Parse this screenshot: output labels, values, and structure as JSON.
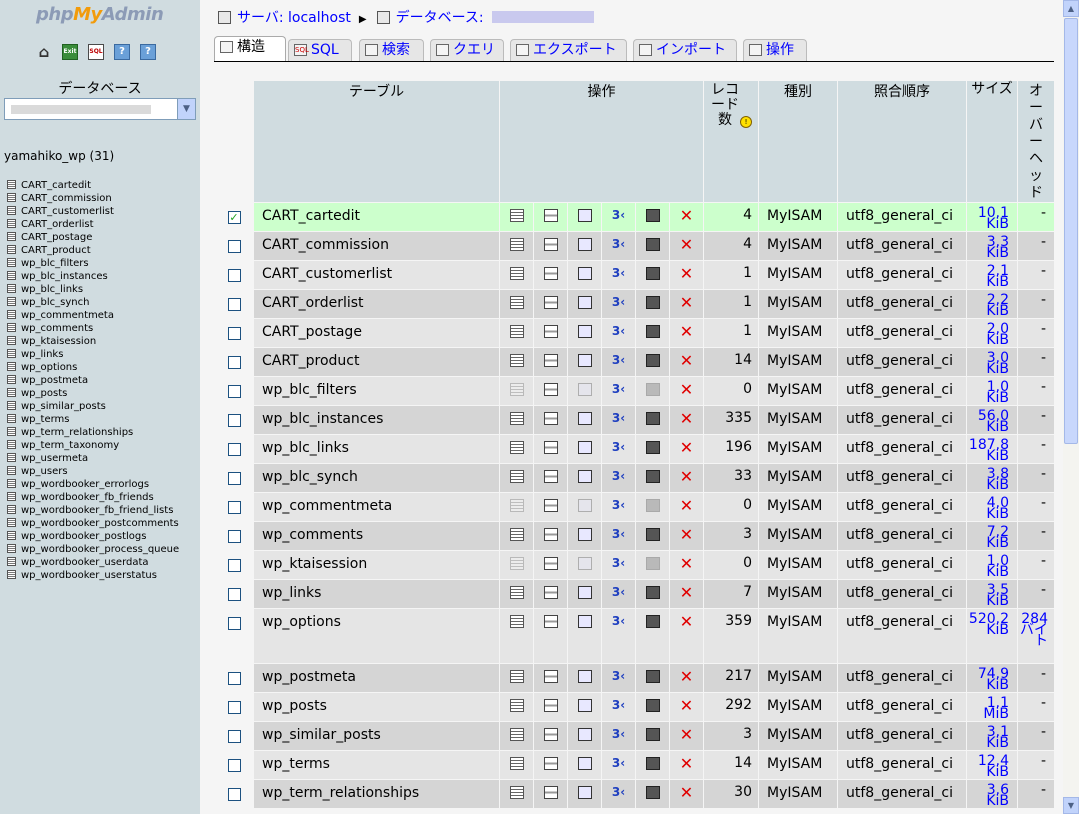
{
  "nav": {
    "logo_php": "php",
    "logo_my": "My",
    "logo_admin": "Admin",
    "database_label": "データベース",
    "current_db": "yamahiko_wp (31)",
    "tables": [
      "CART_cartedit",
      "CART_commission",
      "CART_customerlist",
      "CART_orderlist",
      "CART_postage",
      "CART_product",
      "wp_blc_filters",
      "wp_blc_instances",
      "wp_blc_links",
      "wp_blc_synch",
      "wp_commentmeta",
      "wp_comments",
      "wp_ktaisession",
      "wp_links",
      "wp_options",
      "wp_postmeta",
      "wp_posts",
      "wp_similar_posts",
      "wp_terms",
      "wp_term_relationships",
      "wp_term_taxonomy",
      "wp_usermeta",
      "wp_users",
      "wp_wordbooker_errorlogs",
      "wp_wordbooker_fb_friends",
      "wp_wordbooker_fb_friend_lists",
      "wp_wordbooker_postcomments",
      "wp_wordbooker_postlogs",
      "wp_wordbooker_process_queue",
      "wp_wordbooker_userdata",
      "wp_wordbooker_userstatus"
    ]
  },
  "breadcrumb": {
    "server": "サーバ: localhost",
    "database": "データベース:"
  },
  "tabs": [
    {
      "label": "構造",
      "icon": "structure-icon",
      "active": true
    },
    {
      "label": "SQL",
      "icon": "sql-icon",
      "active": false
    },
    {
      "label": "検索",
      "icon": "search-icon",
      "active": false
    },
    {
      "label": "クエリ",
      "icon": "query-icon",
      "active": false
    },
    {
      "label": "エクスポート",
      "icon": "export-icon",
      "active": false
    },
    {
      "label": "インポート",
      "icon": "import-icon",
      "active": false
    },
    {
      "label": "操作",
      "icon": "operations-icon",
      "active": false
    }
  ],
  "table_headers": {
    "table": "テーブル",
    "action": "操作",
    "records": "レコード数",
    "type": "種別",
    "collation": "照合順序",
    "size": "サイズ",
    "overhead": "オーバーヘッド"
  },
  "rows": [
    {
      "name": "CART_cartedit",
      "records": "4",
      "engine": "MyISAM",
      "collation": "utf8_general_ci",
      "size": "10.1 KiB",
      "overhead": "-",
      "checked": true,
      "empty": false
    },
    {
      "name": "CART_commission",
      "records": "4",
      "engine": "MyISAM",
      "collation": "utf8_general_ci",
      "size": "3.3 KiB",
      "overhead": "-",
      "checked": false,
      "empty": false
    },
    {
      "name": "CART_customerlist",
      "records": "1",
      "engine": "MyISAM",
      "collation": "utf8_general_ci",
      "size": "2.1 KiB",
      "overhead": "-",
      "checked": false,
      "empty": false
    },
    {
      "name": "CART_orderlist",
      "records": "1",
      "engine": "MyISAM",
      "collation": "utf8_general_ci",
      "size": "2.2 KiB",
      "overhead": "-",
      "checked": false,
      "empty": false
    },
    {
      "name": "CART_postage",
      "records": "1",
      "engine": "MyISAM",
      "collation": "utf8_general_ci",
      "size": "2.0 KiB",
      "overhead": "-",
      "checked": false,
      "empty": false
    },
    {
      "name": "CART_product",
      "records": "14",
      "engine": "MyISAM",
      "collation": "utf8_general_ci",
      "size": "3.0 KiB",
      "overhead": "-",
      "checked": false,
      "empty": false
    },
    {
      "name": "wp_blc_filters",
      "records": "0",
      "engine": "MyISAM",
      "collation": "utf8_general_ci",
      "size": "1.0 KiB",
      "overhead": "-",
      "checked": false,
      "empty": true
    },
    {
      "name": "wp_blc_instances",
      "records": "335",
      "engine": "MyISAM",
      "collation": "utf8_general_ci",
      "size": "56.0 KiB",
      "overhead": "-",
      "checked": false,
      "empty": false
    },
    {
      "name": "wp_blc_links",
      "records": "196",
      "engine": "MyISAM",
      "collation": "utf8_general_ci",
      "size": "187.8 KiB",
      "overhead": "-",
      "checked": false,
      "empty": false
    },
    {
      "name": "wp_blc_synch",
      "records": "33",
      "engine": "MyISAM",
      "collation": "utf8_general_ci",
      "size": "3.8 KiB",
      "overhead": "-",
      "checked": false,
      "empty": false
    },
    {
      "name": "wp_commentmeta",
      "records": "0",
      "engine": "MyISAM",
      "collation": "utf8_general_ci",
      "size": "4.0 KiB",
      "overhead": "-",
      "checked": false,
      "empty": true
    },
    {
      "name": "wp_comments",
      "records": "3",
      "engine": "MyISAM",
      "collation": "utf8_general_ci",
      "size": "7.2 KiB",
      "overhead": "-",
      "checked": false,
      "empty": false
    },
    {
      "name": "wp_ktaisession",
      "records": "0",
      "engine": "MyISAM",
      "collation": "utf8_general_ci",
      "size": "1.0 KiB",
      "overhead": "-",
      "checked": false,
      "empty": true
    },
    {
      "name": "wp_links",
      "records": "7",
      "engine": "MyISAM",
      "collation": "utf8_general_ci",
      "size": "3.5 KiB",
      "overhead": "-",
      "checked": false,
      "empty": false
    },
    {
      "name": "wp_options",
      "records": "359",
      "engine": "MyISAM",
      "collation": "utf8_general_ci",
      "size": "520.2 KiB",
      "overhead": "284 バイト",
      "checked": false,
      "empty": false,
      "tall": true
    },
    {
      "name": "wp_postmeta",
      "records": "217",
      "engine": "MyISAM",
      "collation": "utf8_general_ci",
      "size": "74.9 KiB",
      "overhead": "-",
      "checked": false,
      "empty": false
    },
    {
      "name": "wp_posts",
      "records": "292",
      "engine": "MyISAM",
      "collation": "utf8_general_ci",
      "size": "1.1 MiB",
      "overhead": "-",
      "checked": false,
      "empty": false
    },
    {
      "name": "wp_similar_posts",
      "records": "3",
      "engine": "MyISAM",
      "collation": "utf8_general_ci",
      "size": "3.1 KiB",
      "overhead": "-",
      "checked": false,
      "empty": false
    },
    {
      "name": "wp_terms",
      "records": "14",
      "engine": "MyISAM",
      "collation": "utf8_general_ci",
      "size": "12.4 KiB",
      "overhead": "-",
      "checked": false,
      "empty": false
    },
    {
      "name": "wp_term_relationships",
      "records": "30",
      "engine": "MyISAM",
      "collation": "utf8_general_ci",
      "size": "3.6 KiB",
      "overhead": "-",
      "checked": false,
      "empty": false
    }
  ]
}
